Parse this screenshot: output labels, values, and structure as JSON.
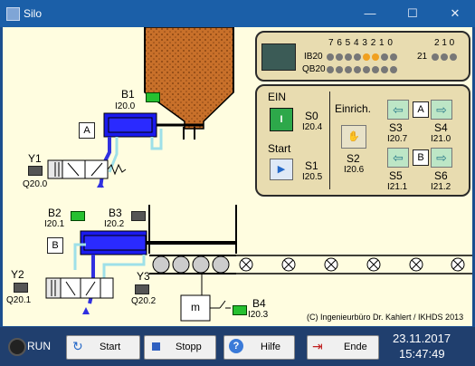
{
  "window": {
    "title": "Silo",
    "minimize": "—",
    "maximize": "☐",
    "close": "✕"
  },
  "plc": {
    "input_label": "IB20",
    "output_label": "QB20",
    "bit_header_left": "7 6 5 4 3 2 1 0",
    "bit_header_right": "2 1 0",
    "byte21_label": "21",
    "ib20_leds": [
      0,
      0,
      0,
      0,
      1,
      1,
      0,
      0
    ],
    "ib21_leds": [
      0,
      0,
      0
    ],
    "qb20_leds": [
      0,
      0,
      0,
      0,
      0,
      0,
      0,
      0
    ],
    "led_on_color": "#f0a020"
  },
  "control": {
    "ein_label": "EIN",
    "s0_label": "S0",
    "s0_addr": "I20.4",
    "start_label": "Start",
    "s1_label": "S1",
    "s1_addr": "I20.5",
    "einrich_label": "Einrich.",
    "s2_label": "S2",
    "s2_addr": "I20.6",
    "s3_label": "S3",
    "s3_addr": "I20.7",
    "s4_label": "S4",
    "s4_addr": "I21.0",
    "s5_label": "S5",
    "s5_addr": "I21.1",
    "s6_label": "S6",
    "s6_addr": "I21.2",
    "box_a": "A",
    "box_b": "B"
  },
  "process": {
    "b1": "B1",
    "b1_addr": "I20.0",
    "cyl_a": "A",
    "y1": "Y1",
    "y1_addr": "Q20.0",
    "b2": "B2",
    "b2_addr": "I20.1",
    "b3": "B3",
    "b3_addr": "I20.2",
    "cyl_b": "B",
    "y2": "Y2",
    "y2_addr": "Q20.1",
    "y3": "Y3",
    "y3_addr": "Q20.2",
    "motor": "m",
    "b4": "B4",
    "b4_addr": "I20.3",
    "copyright": "(C) Ingenieurbüro Dr. Kahlert / IKHDS 2013"
  },
  "bottom": {
    "run_label": "RUN",
    "start_btn": "Start",
    "stopp_btn": "Stopp",
    "hilfe_btn": "Hilfe",
    "ende_btn": "Ende",
    "date": "23.11.2017",
    "time": "15:47:49"
  }
}
